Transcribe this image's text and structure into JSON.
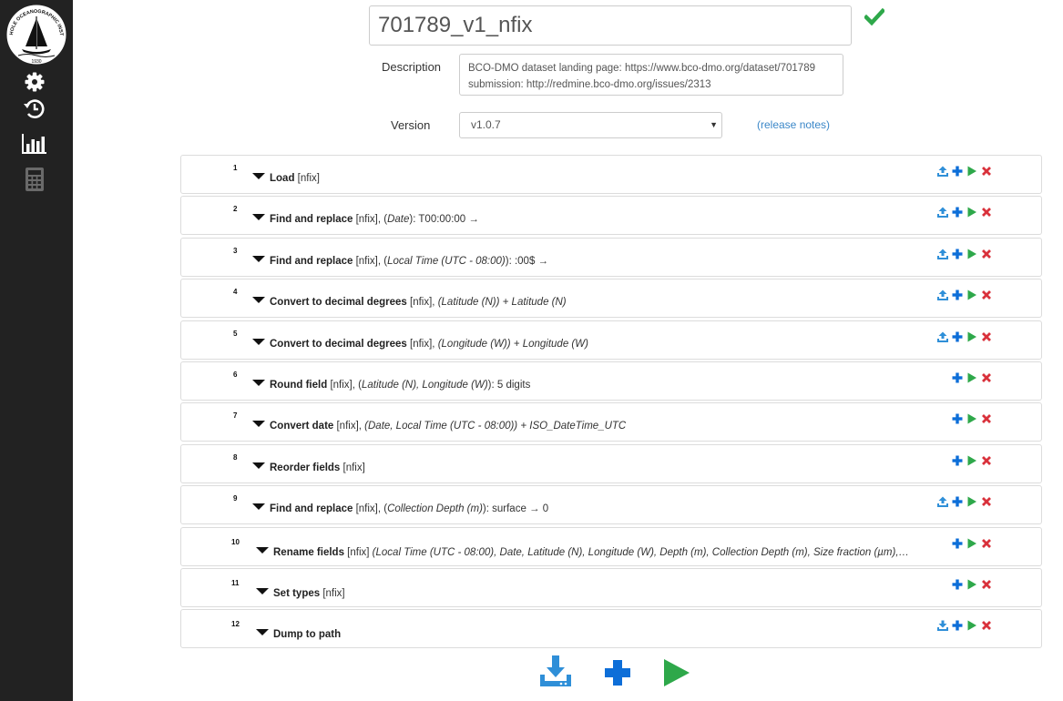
{
  "sidebar": {
    "logo": {
      "text_top": "WOODS HOLE OCEANOGRAPHIC INSTITUTION",
      "year": "1930"
    },
    "items": [
      {
        "icon": "gear-icon"
      },
      {
        "icon": "history-icon"
      },
      {
        "icon": "bar-chart-icon"
      },
      {
        "icon": "calculator-icon"
      }
    ]
  },
  "header": {
    "pipeline_name": "701789_v1_nfix",
    "status_icon": "check-icon",
    "status_color": "#2ea84a"
  },
  "description": {
    "label": "Description",
    "lines": [
      "BCO-DMO dataset landing page: https://www.bco-dmo.org/dataset/701789",
      "submission: http://redmine.bco-dmo.org/issues/2313"
    ]
  },
  "version": {
    "label": "Version",
    "selected": "v1.0.7",
    "release_notes": "(release notes)"
  },
  "colors": {
    "upload": "#2f8fd8",
    "add": "#0d6ed8",
    "run": "#2ea84a",
    "remove": "#d9313b",
    "sidebar_bg": "#222222"
  },
  "steps": [
    {
      "num": "1",
      "title": "Load",
      "parts": [
        " [nfix]"
      ],
      "actions": [
        "upload",
        "add",
        "run",
        "remove"
      ]
    },
    {
      "num": "2",
      "title": "Find and replace",
      "parts": [
        " [nfix], (",
        {
          "i": "Date"
        },
        "): T00:00:00 →"
      ],
      "actions": [
        "upload",
        "add",
        "run",
        "remove"
      ]
    },
    {
      "num": "3",
      "title": "Find and replace",
      "parts": [
        " [nfix], (",
        {
          "i": "Local Time (UTC - 08:00)"
        },
        "): :00$ →"
      ],
      "actions": [
        "upload",
        "add",
        "run",
        "remove"
      ]
    },
    {
      "num": "4",
      "title": "Convert to decimal degrees",
      "parts": [
        " [nfix], ",
        {
          "i": "(Latitude (N)) + Latitude (N)"
        }
      ],
      "actions": [
        "upload",
        "add",
        "run",
        "remove"
      ]
    },
    {
      "num": "5",
      "title": "Convert to decimal degrees",
      "parts": [
        " [nfix], ",
        {
          "i": "(Longitude (W)) + Longitude (W)"
        }
      ],
      "actions": [
        "upload",
        "add",
        "run",
        "remove"
      ]
    },
    {
      "num": "6",
      "title": "Round field",
      "parts": [
        " [nfix], (",
        {
          "i": "Latitude (N), Longitude (W)"
        },
        "): 5 digits"
      ],
      "actions": [
        "add",
        "run",
        "remove"
      ]
    },
    {
      "num": "7",
      "title": "Convert date",
      "parts": [
        " [nfix], ",
        {
          "i": "(Date, Local Time (UTC - 08:00)) + ISO_DateTime_UTC"
        }
      ],
      "actions": [
        "add",
        "run",
        "remove"
      ]
    },
    {
      "num": "8",
      "title": "Reorder fields",
      "parts": [
        " [nfix]"
      ],
      "actions": [
        "add",
        "run",
        "remove"
      ]
    },
    {
      "num": "9",
      "title": "Find and replace",
      "parts": [
        " [nfix], (",
        {
          "i": "Collection Depth (m)"
        },
        "): surface → 0"
      ],
      "actions": [
        "upload",
        "add",
        "run",
        "remove"
      ]
    },
    {
      "num": "10",
      "title": "Rename fields",
      "parts": [
        " [nfix] ",
        {
          "i": "(Local Time (UTC - 08:00), Date, Latitude (N), Longitude (W), Depth (m), Collection Depth (m), Size fraction (µm),…"
        }
      ],
      "actions": [
        "add",
        "run",
        "remove"
      ]
    },
    {
      "num": "11",
      "title": "Set types",
      "parts": [
        " [nfix]"
      ],
      "actions": [
        "add",
        "run",
        "remove"
      ]
    },
    {
      "num": "12",
      "title": "Dump to path",
      "parts": [],
      "actions": [
        "download",
        "add",
        "run",
        "remove"
      ]
    }
  ],
  "bottom_actions": [
    {
      "icon": "download-icon",
      "color": "#2f8fd8"
    },
    {
      "icon": "plus-icon",
      "color": "#0d6ed8"
    },
    {
      "icon": "play-icon",
      "color": "#2ea84a"
    }
  ]
}
